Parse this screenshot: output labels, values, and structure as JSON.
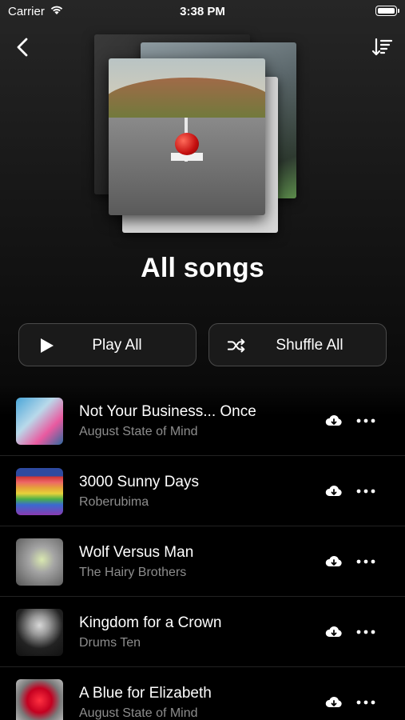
{
  "status_bar": {
    "carrier": "Carrier",
    "time": "3:38 PM"
  },
  "header": {
    "title": "All songs"
  },
  "actions": {
    "play_all": "Play All",
    "shuffle_all": "Shuffle All"
  },
  "songs": [
    {
      "title": "Not Your Business... Once",
      "artist": "August State of Mind"
    },
    {
      "title": "3000 Sunny Days",
      "artist": "Roberubima"
    },
    {
      "title": "Wolf Versus Man",
      "artist": "The Hairy Brothers"
    },
    {
      "title": "Kingdom for a Crown",
      "artist": "Drums Ten"
    },
    {
      "title": "A Blue for Elizabeth",
      "artist": "August State of Mind"
    }
  ],
  "colors": {
    "background": "#000000",
    "text": "#ffffff",
    "secondary_text": "#8d8d8d",
    "button_border": "#4a4a4a"
  },
  "icons": {
    "back": "chevron-left-icon",
    "sort": "sort-descending-icon",
    "play": "play-icon",
    "shuffle": "shuffle-icon",
    "download": "cloud-download-icon",
    "more": "more-horizontal-icon"
  }
}
